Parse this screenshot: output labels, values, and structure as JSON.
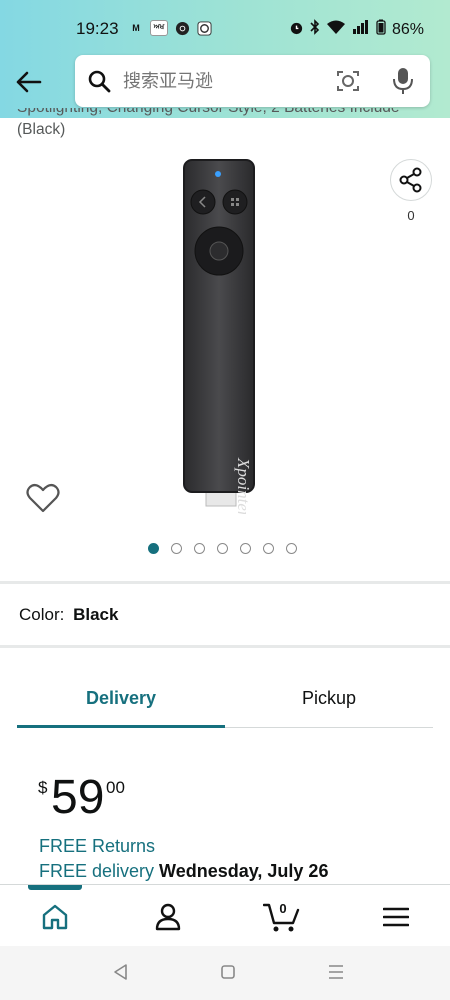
{
  "status_bar": {
    "time": "19:23",
    "apps": [
      "M",
      "ਅਖ"
    ],
    "battery": "86%"
  },
  "search": {
    "placeholder": "搜索亚马逊"
  },
  "product": {
    "title_line1": "Spotlighting, Changing Cursor Style, 2 Batteries Include",
    "title_line2": "(Black)",
    "brand_mark": "Xpointer",
    "share_count": "0",
    "image_count": 7,
    "active_image": 1
  },
  "color": {
    "label": "Color:",
    "value": "Black"
  },
  "tabs": {
    "delivery": "Delivery",
    "pickup": "Pickup"
  },
  "price": {
    "symbol": "$",
    "whole": "59",
    "fraction": "00"
  },
  "shipping": {
    "free_returns": "FREE Returns",
    "free_delivery": "FREE delivery",
    "delivery_date": "Wednesday, July 26"
  },
  "bottom_nav": {
    "cart_count": "0"
  },
  "colors": {
    "accent": "#16707e",
    "header_start": "#84d8e3",
    "header_end": "#b2ead0"
  }
}
